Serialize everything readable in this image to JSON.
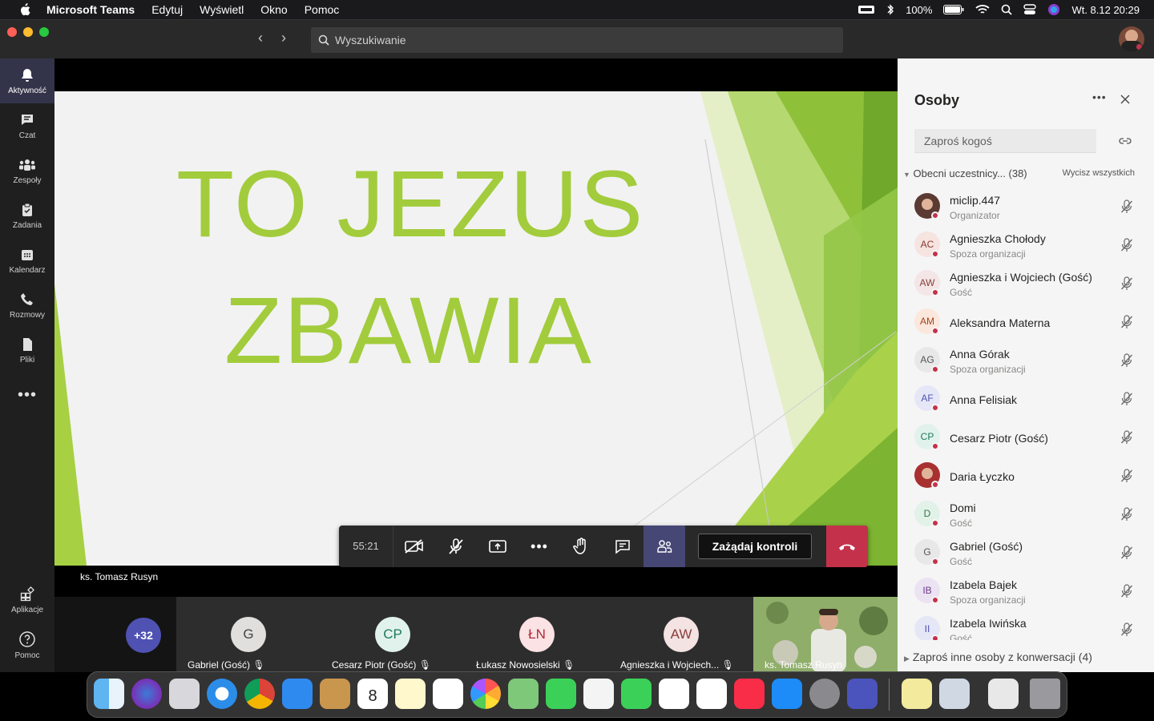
{
  "menubar": {
    "app": "Microsoft Teams",
    "items": [
      "Edytuj",
      "Wyświetl",
      "Okno",
      "Pomoc"
    ],
    "battery": "100%",
    "datetime": "Wt. 8.12  20:29"
  },
  "search": {
    "placeholder": "Wyszukiwanie"
  },
  "rail": [
    {
      "label": "Aktywność",
      "icon": "bell-icon"
    },
    {
      "label": "Czat",
      "icon": "chat-icon"
    },
    {
      "label": "Zespoły",
      "icon": "teams-icon"
    },
    {
      "label": "Zadania",
      "icon": "tasks-icon"
    },
    {
      "label": "Kalendarz",
      "icon": "calendar-icon"
    },
    {
      "label": "Rozmowy",
      "icon": "phone-icon"
    },
    {
      "label": "Pliki",
      "icon": "file-icon"
    }
  ],
  "rail_bottom": [
    {
      "label": "Aplikacje",
      "icon": "apps-icon"
    },
    {
      "label": "Pomoc",
      "icon": "help-icon"
    }
  ],
  "slide": {
    "line1": "TO JEZUS",
    "line2": "ZBAWIA"
  },
  "presenter": "ks. Tomasz Rusyn",
  "controls": {
    "timer": "55:21",
    "request_control": "Zażądaj kontroli"
  },
  "strip": {
    "more": "+32",
    "tiles": [
      {
        "initials": "G",
        "name": "Gabriel (Gość)",
        "color": "#e1dfdd",
        "fg": "#444"
      },
      {
        "initials": "CP",
        "name": "Cesarz Piotr (Gość)",
        "color": "#e1f2ec",
        "fg": "#1d7a5b"
      },
      {
        "initials": "ŁN",
        "name": "Łukasz Nowosielski",
        "color": "#fbe2e4",
        "fg": "#b02b3a"
      },
      {
        "initials": "AW",
        "name": "Agnieszka i Wojciech...",
        "color": "#f4e3e3",
        "fg": "#8a3d3d"
      }
    ],
    "video_name": "ks. Tomasz Rusyn"
  },
  "people": {
    "title": "Osoby",
    "invite_placeholder": "Zaproś kogoś",
    "section": "Obecni uczestnicy...  (38)",
    "mute_all": "Wycisz wszystkich",
    "invite_others": "Zaproś inne osoby z konwersacji  (4)",
    "list": [
      {
        "initials": "",
        "name": "miclip.447",
        "sub": "Organizator",
        "bg": "#5a3a32",
        "fg": "#fff",
        "photo": true
      },
      {
        "initials": "AC",
        "name": "Agnieszka Chołody",
        "sub": "Spoza organizacji",
        "bg": "#f6e4e1",
        "fg": "#8a3a2f"
      },
      {
        "initials": "AW",
        "name": "Agnieszka i Wojciech (Gość)",
        "sub": "Gość",
        "bg": "#f4e6e6",
        "fg": "#8a3d3d"
      },
      {
        "initials": "AM",
        "name": "Aleksandra Materna",
        "sub": "",
        "bg": "#fbe7dc",
        "fg": "#a5441d"
      },
      {
        "initials": "AG",
        "name": "Anna Górak",
        "sub": "Spoza organizacji",
        "bg": "#e8e8e8",
        "fg": "#555"
      },
      {
        "initials": "AF",
        "name": "Anna Felisiak",
        "sub": "",
        "bg": "#e5e7f7",
        "fg": "#4f52b2"
      },
      {
        "initials": "CP",
        "name": "Cesarz Piotr (Gość)",
        "sub": "",
        "bg": "#e1f2ec",
        "fg": "#1d7a5b"
      },
      {
        "initials": "",
        "name": "Daria Łyczko",
        "sub": "",
        "bg": "#a83030",
        "fg": "#fff",
        "photo": true
      },
      {
        "initials": "D",
        "name": "Domi",
        "sub": "Gość",
        "bg": "#e3f2e8",
        "fg": "#2f7a45"
      },
      {
        "initials": "G",
        "name": "Gabriel (Gość)",
        "sub": "Gość",
        "bg": "#e8e8e8",
        "fg": "#555"
      },
      {
        "initials": "IB",
        "name": "Izabela Bajek",
        "sub": "Spoza organizacji",
        "bg": "#ece3f2",
        "fg": "#6b3a8a"
      },
      {
        "initials": "II",
        "name": "Izabela Iwińska",
        "sub": "Gość",
        "bg": "#e5e7f7",
        "fg": "#4f52b2"
      }
    ]
  }
}
